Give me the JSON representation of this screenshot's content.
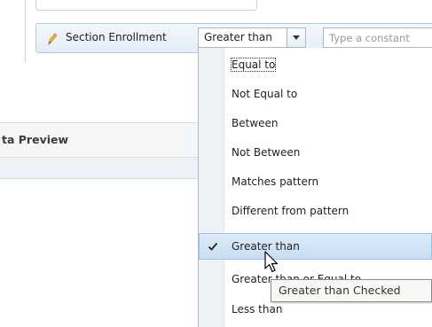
{
  "filter": {
    "label": "Section Enrollment",
    "operator": "Greater than",
    "constant_placeholder": "Type a constant"
  },
  "panel": {
    "title": "ta Preview"
  },
  "menu": {
    "items": [
      {
        "label": "Equal to",
        "state": "focused"
      },
      {
        "label": "Not Equal to",
        "state": "normal"
      },
      {
        "label": "Between",
        "state": "normal"
      },
      {
        "label": "Not Between",
        "state": "normal"
      },
      {
        "label": "Matches pattern",
        "state": "normal"
      },
      {
        "label": "Different from pattern",
        "state": "normal"
      },
      {
        "label": "Greater than",
        "state": "selected"
      },
      {
        "label": "Greater than or Equal to",
        "state": "normal"
      },
      {
        "label": "Less than",
        "state": "normal"
      }
    ]
  },
  "tooltip": {
    "text": "Greater than Checked"
  },
  "icons": {
    "filter_icon": "pencil-icon",
    "operator_toggle": "chevron-down-icon",
    "selected_marker": "check-icon",
    "pointer": "cursor-icon"
  },
  "colors": {
    "selected_bg": "#c9def3",
    "selected_border": "#9ec3e6",
    "row_bg": "#e4edf6"
  }
}
